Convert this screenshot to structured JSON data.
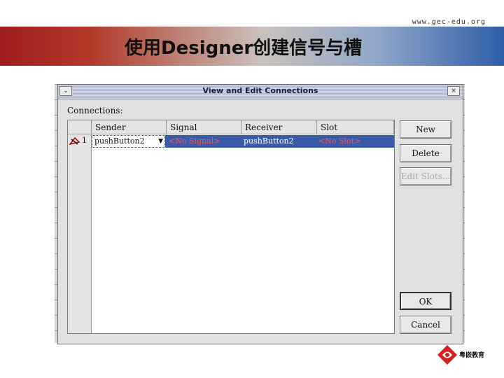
{
  "header": {
    "url": "www.gec-edu.org",
    "title": "使用Designer创建信号与槽"
  },
  "dialog": {
    "title": "View and Edit Connections",
    "menu_button": "⌄",
    "close_button": "×",
    "connections_label": "Connections:",
    "columns": [
      "Sender",
      "Signal",
      "Receiver",
      "Slot"
    ],
    "rows": [
      {
        "number": "1",
        "sender": "pushButton2",
        "signal": "<No Signal>",
        "receiver": "pushButton2",
        "slot": "<No Slot>"
      }
    ],
    "buttons": {
      "new": "New",
      "delete": "Delete",
      "edit_slots": "Edit Slots...",
      "ok": "OK",
      "cancel": "Cancel"
    }
  },
  "footer": {
    "logo_text": "粤嵌教育"
  },
  "colors": {
    "selection": "#3a5ba8",
    "invalid_text": "#e02020",
    "band_left": "#9f1d1d",
    "band_right": "#2f5ea8"
  }
}
